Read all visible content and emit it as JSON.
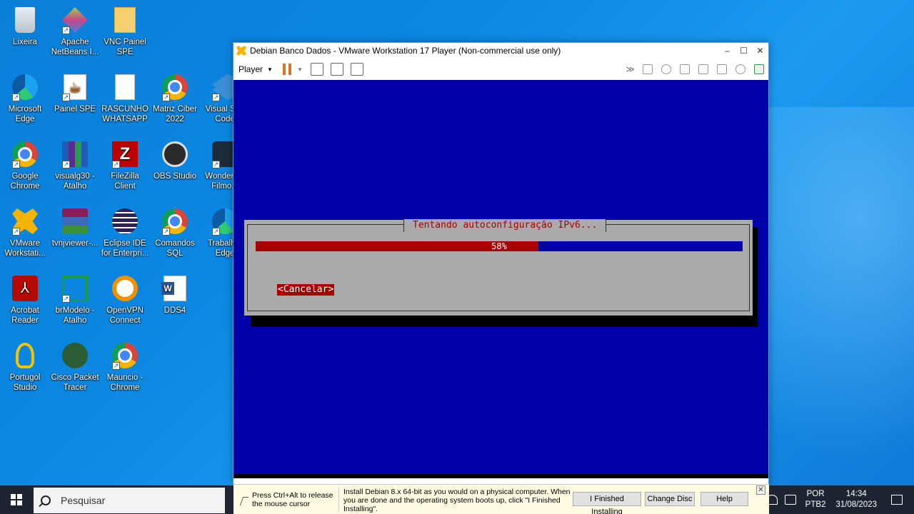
{
  "desktop": {
    "icons": [
      {
        "label": "Lixeira",
        "icon": "recycle-bin-icon"
      },
      {
        "label": "Apache NetBeans I...",
        "icon": "netbeans-icon"
      },
      {
        "label": "VNC Painel SPE",
        "icon": "folder-icon"
      },
      {
        "label": "Microsoft Edge",
        "icon": "edge-icon"
      },
      {
        "label": "Painel SPE",
        "icon": "java-icon"
      },
      {
        "label": "RASCUNHO WHATSAPP",
        "icon": "document-icon"
      },
      {
        "label": "Matriz Ciber 2022",
        "icon": "chrome-icon"
      },
      {
        "label": "Visual St... Code",
        "icon": "vscode-icon"
      },
      {
        "label": "Google Chrome",
        "icon": "chrome-icon"
      },
      {
        "label": "visualg30 - Atalho",
        "icon": "books-icon"
      },
      {
        "label": "FileZilla Client",
        "icon": "filezilla-icon"
      },
      {
        "label": "OBS Studio",
        "icon": "obs-icon"
      },
      {
        "label": "Wonders... Filmo...",
        "icon": "filmora-icon"
      },
      {
        "label": "VMware Workstati...",
        "icon": "vmware-icon"
      },
      {
        "label": "tvnjviewer-...",
        "icon": "winrar-icon"
      },
      {
        "label": "Eclipse IDE for Enterpri...",
        "icon": "eclipse-icon"
      },
      {
        "label": "Comandos SQL",
        "icon": "chrome-icon"
      },
      {
        "label": "Trabalh... Edge",
        "icon": "edge-icon"
      },
      {
        "label": "Acrobat Reader",
        "icon": "acrobat-icon"
      },
      {
        "label": "brModelo - Atalho",
        "icon": "brmodelo-icon"
      },
      {
        "label": "OpenVPN Connect",
        "icon": "openvpn-icon"
      },
      {
        "label": "DDS4",
        "icon": "word-icon"
      },
      {
        "label": "Portugol Studio",
        "icon": "lightbulb-icon"
      },
      {
        "label": "Cisco Packet Tracer",
        "icon": "cisco-icon"
      },
      {
        "label": "Mauricio - Chrome",
        "icon": "chrome-icon"
      }
    ]
  },
  "vmware": {
    "title": "Debian Banco Dados - VMware Workstation 17 Player (Non-commercial use only)",
    "player_label": "Player",
    "window_buttons": {
      "minimize": "–",
      "maximize": "☐",
      "close": "✕"
    }
  },
  "installer": {
    "dialog_title": "Tentando autoconfiguração IPv6...",
    "progress_percent": 58,
    "progress_text": "58%",
    "cancel_label": "<Cancelar>",
    "colors": {
      "background": "#0000a8",
      "dialog": "#aaaaaa",
      "accent": "#a80000"
    }
  },
  "hintbar": {
    "release_text": "Press Ctrl+Alt to release the mouse cursor",
    "install_text": "Install Debian 8.x 64-bit as you would on a physical computer. When you are done and the operating system boots up, click \"I Finished Installing\".",
    "finished_button": "I Finished Installing",
    "change_disc_button": "Change Disc",
    "help_button": "Help"
  },
  "taskbar": {
    "search_placeholder": "Pesquisar",
    "language": "POR",
    "keyboard": "PTB2",
    "time": "14:34",
    "date": "31/08/2023"
  }
}
